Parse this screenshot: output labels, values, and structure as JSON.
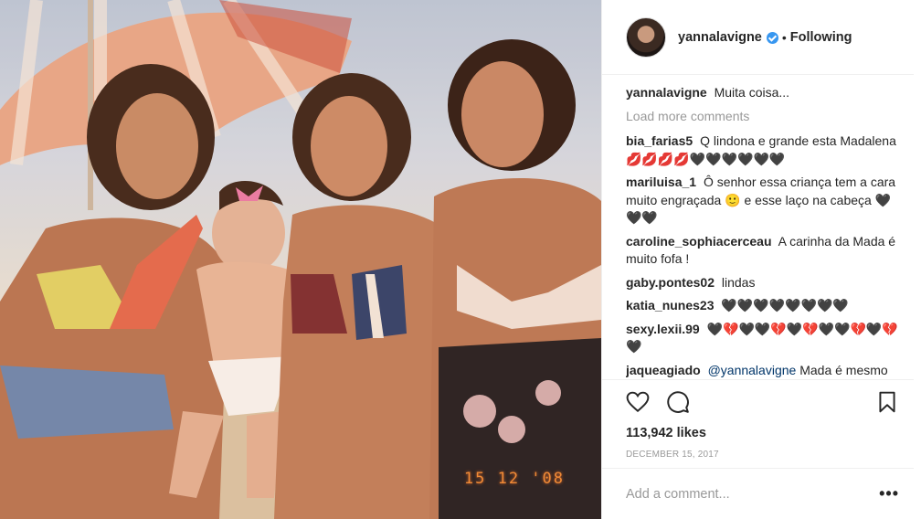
{
  "photo": {
    "alt": "beach photo",
    "date_stamp": "15 12 '08"
  },
  "header": {
    "username": "yannalavigne",
    "separator": "•",
    "follow_status": "Following"
  },
  "caption": {
    "user": "yannalavigne",
    "text": "Muita coisa..."
  },
  "load_more_label": "Load more comments",
  "comments": [
    {
      "user": "bia_farias5",
      "text": "Q lindona e grande esta Madalena💋💋💋💋🖤🖤🖤🖤🖤🖤"
    },
    {
      "user": "mariluisa_1",
      "text": "Ô senhor essa criança tem a cara muito engraçada 🙂 e esse laço na cabeça 🖤🖤🖤"
    },
    {
      "user": "caroline_sophiacerceau",
      "text": "A carinha da Mada é muito fofa !"
    },
    {
      "user": "gaby.pontes02",
      "text": "lindas"
    },
    {
      "user": "katia_nunes23",
      "text": "🖤🖤🖤🖤🖤🖤🖤🖤"
    },
    {
      "user": "sexy.lexii.99",
      "text": "🖤💔🖤🖤💔🖤💔🖤🖤💔🖤💔🖤"
    },
    {
      "user": "jaqueagiado",
      "mention": "@yannalavigne",
      "text": "Mada é mesmo uma mistura de vcs dois. Ela é uma"
    }
  ],
  "icons": {
    "like": "heart-icon",
    "comment": "comment-icon",
    "save": "bookmark-icon"
  },
  "likes": "113,942 likes",
  "date": "DECEMBER 15, 2017",
  "add_comment": {
    "placeholder": "Add a comment...",
    "more_label": "•••"
  }
}
